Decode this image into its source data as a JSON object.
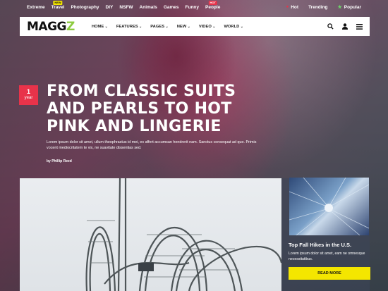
{
  "topbar": {
    "categories": [
      {
        "label": "Extreme",
        "tag": ""
      },
      {
        "label": "Travel",
        "tag": "NEW"
      },
      {
        "label": "Photography",
        "tag": ""
      },
      {
        "label": "DIY",
        "tag": ""
      },
      {
        "label": "NSFW",
        "tag": ""
      },
      {
        "label": "Animals",
        "tag": ""
      },
      {
        "label": "Games",
        "tag": ""
      },
      {
        "label": "Funny",
        "tag": ""
      },
      {
        "label": "People",
        "tag": "HOT"
      }
    ],
    "right": [
      {
        "label": "Hot",
        "icon": "fire-icon"
      },
      {
        "label": "Trending",
        "icon": ""
      },
      {
        "label": "Popular",
        "icon": "star-icon"
      }
    ]
  },
  "nav": {
    "logo_main": "MAGG",
    "logo_accent": "Z",
    "items": [
      "HOME",
      "FEATURES",
      "PAGES",
      "NEW",
      "VIDEO",
      "WORLD"
    ],
    "icons": [
      "search-icon",
      "user-icon",
      "menu-icon"
    ]
  },
  "hero": {
    "date_num": "1",
    "date_unit": "year",
    "headline": "FROM CLASSIC SUITS AND PEARLS TO HOT PINK AND LINGERIE",
    "excerpt": "Lorem ipsum dolor sit amet, ullum theophrastus id mei, ex affert accumsan hendrerit nam. Sanctus consequat ad quo. Primis vocent mediocritatem te vix, ne suavitate dissentias sed.",
    "byline": "by Phillip Reed"
  },
  "side_card": {
    "title": "Top Fall Hikes in the U.S.",
    "text": "Lorem ipsum dolor sit amet, eam ne omnesque necessitatibus.",
    "button": "READ MORE"
  },
  "colors": {
    "accent_red": "#e8334a",
    "accent_yellow": "#f4e600",
    "logo_green": "#8dcb3f"
  }
}
